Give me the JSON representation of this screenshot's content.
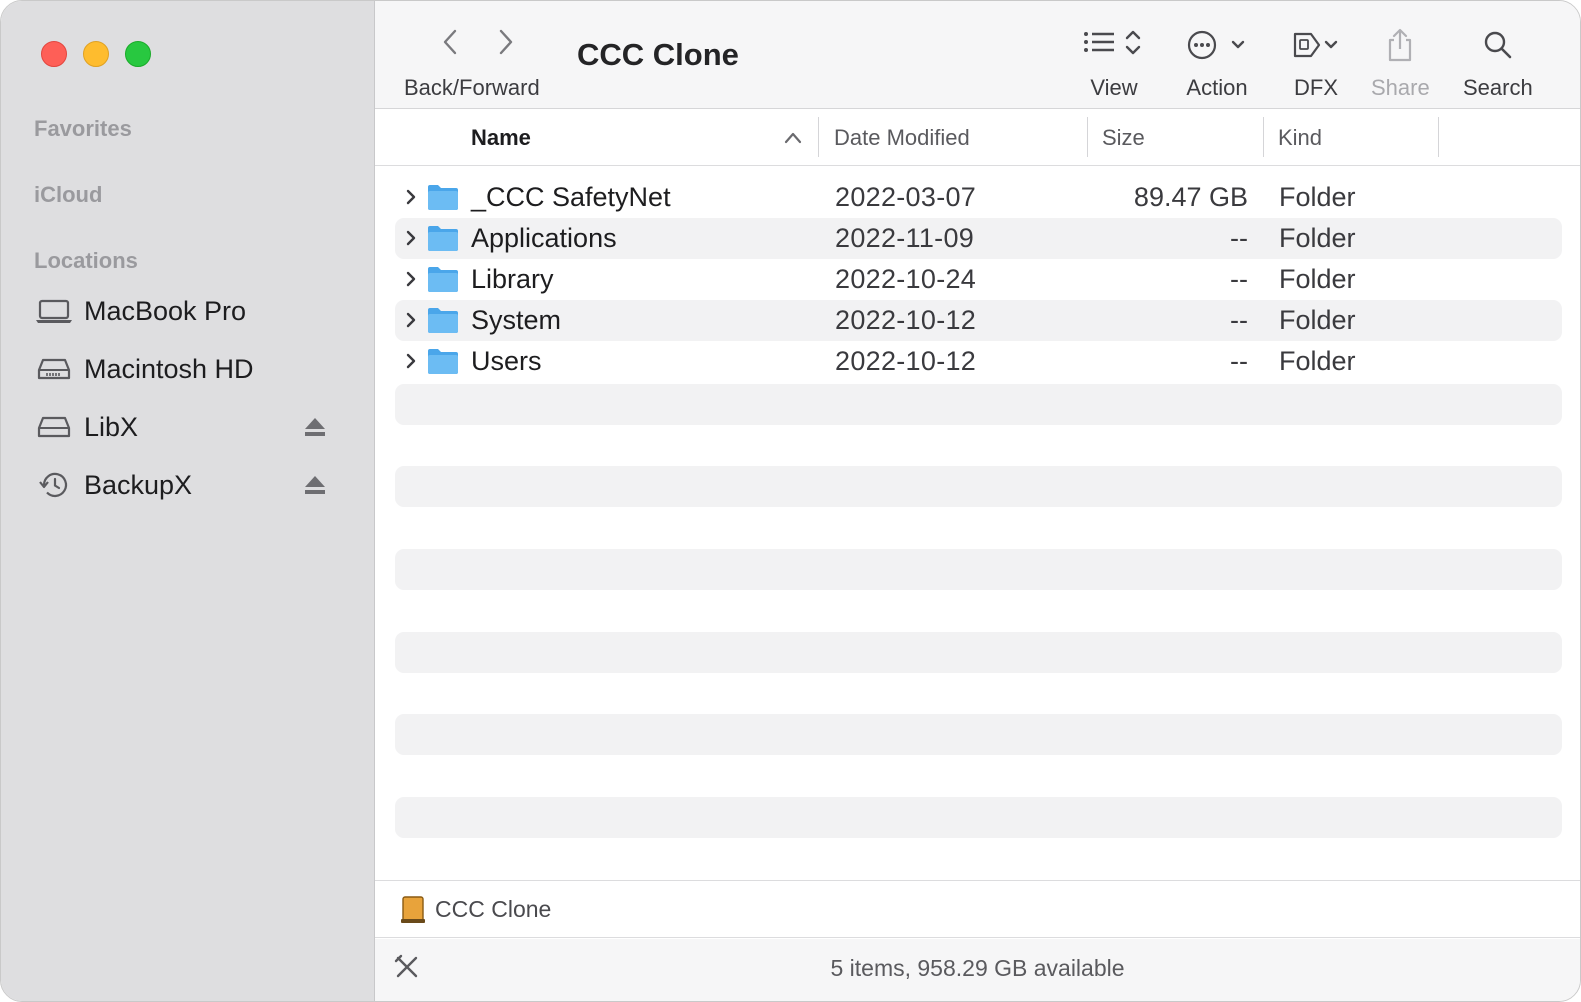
{
  "window": {
    "title": "CCC Clone"
  },
  "sidebar": {
    "sections": {
      "favorites": "Favorites",
      "icloud": "iCloud",
      "locations": "Locations"
    },
    "locations": [
      {
        "label": "MacBook Pro",
        "icon": "laptop-icon",
        "eject": false
      },
      {
        "label": "Macintosh HD",
        "icon": "internal-drive-icon",
        "eject": false
      },
      {
        "label": "LibX",
        "icon": "external-drive-icon",
        "eject": true
      },
      {
        "label": "BackupX",
        "icon": "time-machine-icon",
        "eject": true
      }
    ]
  },
  "toolbar": {
    "nav_label": "Back/Forward",
    "view_label": "View",
    "action_label": "Action",
    "dfx_label": "DFX",
    "share_label": "Share",
    "search_label": "Search"
  },
  "columns": {
    "name": "Name",
    "date": "Date Modified",
    "size": "Size",
    "kind": "Kind"
  },
  "files": [
    {
      "name": "_CCC SafetyNet",
      "date": "2022-03-07",
      "size": "89.47 GB",
      "kind": "Folder"
    },
    {
      "name": "Applications",
      "date": "2022-11-09",
      "size": "--",
      "kind": "Folder"
    },
    {
      "name": "Library",
      "date": "2022-10-24",
      "size": "--",
      "kind": "Folder"
    },
    {
      "name": "System",
      "date": "2022-10-12",
      "size": "--",
      "kind": "Folder"
    },
    {
      "name": "Users",
      "date": "2022-10-12",
      "size": "--",
      "kind": "Folder"
    }
  ],
  "pathbar": {
    "item": "CCC Clone"
  },
  "status": {
    "text": "5 items, 958.29 GB available"
  },
  "colors": {
    "folder": "#5fb4f0",
    "close": "#fe5f57",
    "minimize": "#febc2e",
    "maximize": "#28c840",
    "sidebar_bg": "#dedee0"
  }
}
